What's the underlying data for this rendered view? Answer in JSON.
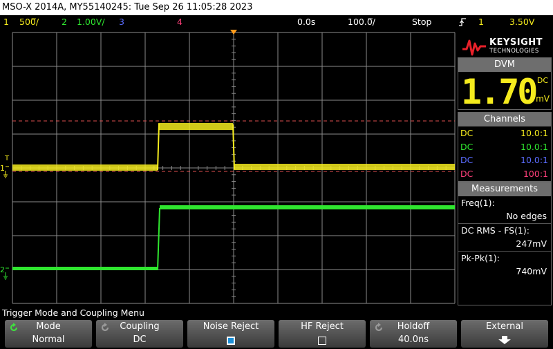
{
  "title_bar": {
    "text": "MSO-X 2014A, MY55140245: Tue Sep 26 11:05:28 2023"
  },
  "status_bar": {
    "ch1_num": "1",
    "ch1_scale": "500̅/",
    "ch2_num": "2",
    "ch2_scale": "1.00V/",
    "ch3_num": "3",
    "ch4_num": "4",
    "delay": "0.0s",
    "timebase": "100.0̅/",
    "run_state": "Stop",
    "trigger_icon": "trigger-rising-edge-icon",
    "trigger_source": "1",
    "trigger_level": "3.50V"
  },
  "colors": {
    "ch1": "#f5eb1d",
    "ch2": "#2fe62f",
    "ch3": "#5a6cff",
    "ch4": "#ff3f7a",
    "grid": "#8c8c8c",
    "trigger_dash": "#e05050",
    "panel_header": "#6e6e6e"
  },
  "waveform_markers": {
    "ch1_label": "1",
    "ch2_label": "2",
    "trigger_label": "T"
  },
  "brand": {
    "name": "KEYSIGHT",
    "sub": "TECHNOLOGIES"
  },
  "dvm": {
    "header": "DVM",
    "mode": "DC",
    "value": "1.70",
    "unit": "mV"
  },
  "channels": {
    "header": "Channels",
    "items": [
      {
        "coupling": "DC",
        "probe": "10.0:1",
        "color": "#f5eb1d"
      },
      {
        "coupling": "DC",
        "probe": "10.0:1",
        "color": "#2fe62f"
      },
      {
        "coupling": "DC",
        "probe": "10.0:1",
        "color": "#5a6cff"
      },
      {
        "coupling": "DC",
        "probe": "100:1",
        "color": "#ff3f7a"
      }
    ]
  },
  "measurements": {
    "header": "Measurements",
    "items": [
      {
        "label": "Freq(1):",
        "value": "No edges"
      },
      {
        "label": "DC RMS - FS(1):",
        "value": "247mV"
      },
      {
        "label": "Pk-Pk(1):",
        "value": "740mV"
      }
    ]
  },
  "menu": {
    "title": "Trigger Mode and Coupling Menu"
  },
  "softkeys": [
    {
      "label": "Mode",
      "value": "Normal",
      "icon": "entry-knob-icon"
    },
    {
      "label": "Coupling",
      "value": "DC",
      "icon": "entry-knob-icon"
    },
    {
      "label": "Noise Reject",
      "checked": true
    },
    {
      "label": "HF Reject",
      "checked": false
    },
    {
      "label": "Holdoff",
      "value": "40.0ns",
      "icon": "entry-knob-icon"
    },
    {
      "label": "External",
      "icon": "arrow-down-icon"
    }
  ]
}
